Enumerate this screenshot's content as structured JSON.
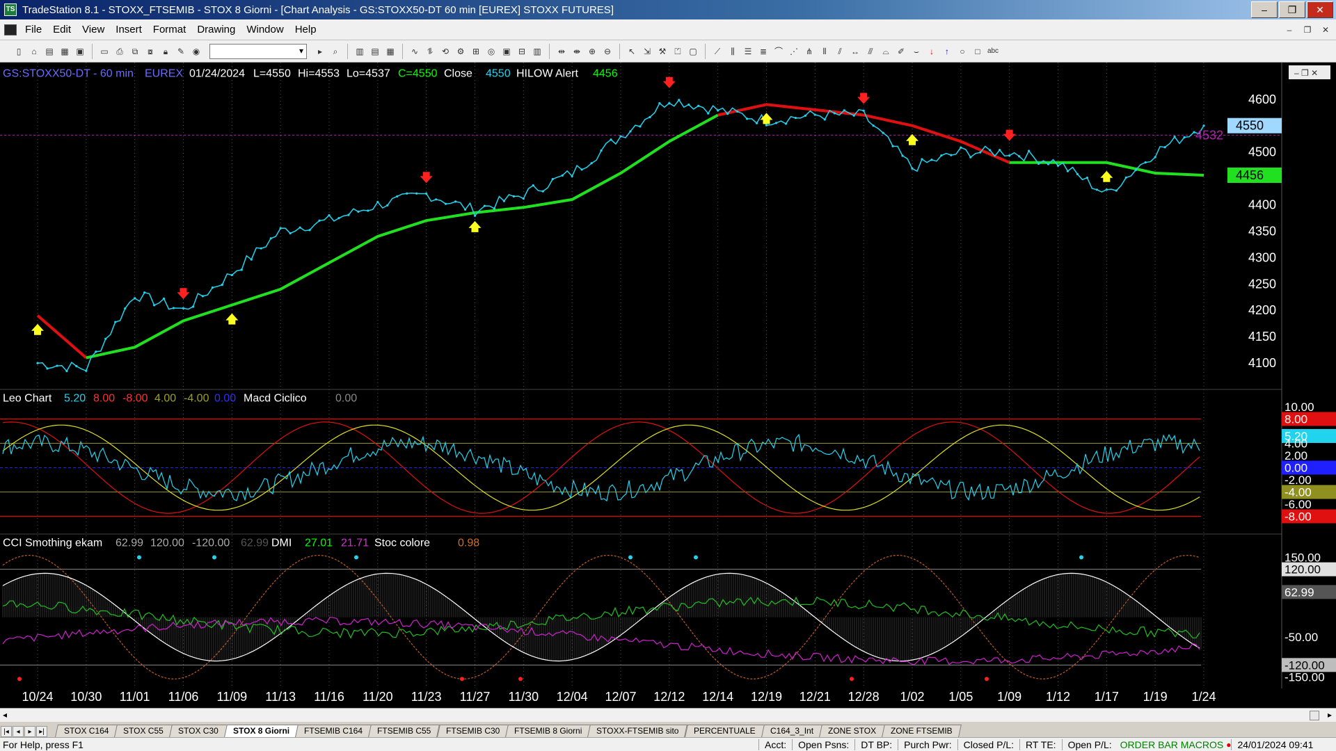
{
  "window": {
    "title": "TradeStation 8.1 - STOXX_FTSEMIB - STOX  8 Giorni - [Chart Analysis - GS:STOXX50-DT  60 min  [EUREX] STOXX FUTURES]"
  },
  "menu": [
    "File",
    "Edit",
    "View",
    "Insert",
    "Format",
    "Drawing",
    "Window",
    "Help"
  ],
  "header": {
    "symbol": "GS:STOXX50-DT - 60 min",
    "exchange": "EUREX",
    "date": "01/24/2024",
    "low": "L=4550",
    "hi": "Hi=4553",
    "lo": "Lo=4537",
    "close": "C=4550",
    "close_label": "Close",
    "close_value": "4550",
    "alert_label": "HILOW Alert",
    "alert_value": "4456"
  },
  "sub1": {
    "name": "Leo Chart",
    "v1": "5.20",
    "v2": "8.00",
    "v3": "-8.00",
    "v4": "4.00",
    "v5": "-4.00",
    "v6": "0.00",
    "name2": "Macd Ciclico",
    "v7": "0.00"
  },
  "sub2": {
    "name": "CCI Smothing ekam",
    "v1": "62.99",
    "v2": "120.00",
    "v3": "-120.00",
    "v4": "62.99",
    "name2": "DMI",
    "v5": "27.01",
    "v6": "21.71",
    "name3": "Stoc colore",
    "v7": "0.98"
  },
  "price_axis": {
    "ticks": [
      4600,
      4550,
      4500,
      4450,
      4400,
      4350,
      4300,
      4250,
      4200,
      4150,
      4100
    ],
    "marker_prev": "4532",
    "marker_close": "4550",
    "marker_alert": "4456"
  },
  "sub1_axis": {
    "ticks": [
      "10.00",
      "8.00",
      "5.20",
      "4.00",
      "2.00",
      "0.00",
      "-2.00",
      "-4.00",
      "-6.00",
      "-8.00"
    ]
  },
  "sub2_axis": {
    "ticks": [
      "150.00",
      "120.00",
      "62.99",
      "-50.00",
      "-120.00",
      "-150.00"
    ]
  },
  "dates": [
    "10/24",
    "10/30",
    "11/01",
    "11/06",
    "11/09",
    "11/13",
    "11/16",
    "11/20",
    "11/23",
    "11/27",
    "11/30",
    "12/04",
    "12/07",
    "12/12",
    "12/14",
    "12/19",
    "12/21",
    "12/28",
    "1/02",
    "1/05",
    "1/09",
    "1/12",
    "1/17",
    "1/19",
    "1/24"
  ],
  "tabs": [
    "STOX C164",
    "STOX C55",
    "STOX  C30",
    "STOX  8 Giorni",
    "FTSEMIB C164",
    "FTSEMIB C55",
    "FTSEMIB C30",
    "FTSEMIB  8 Giorni",
    "STOXX-FTSEMIB sito",
    "PERCENTUALE",
    "C164_3_Int",
    "ZONE STOX",
    "ZONE FTSEMIB"
  ],
  "active_tab": 3,
  "status": {
    "help": "For Help, press F1",
    "acct": "Acct:",
    "open_psns": "Open Psns:",
    "dt_bp": "DT BP:",
    "purch_pwr": "Purch Pwr:",
    "closed_pl": "Closed P/L:",
    "rt_te": "RT TE:",
    "open_pl": "Open P/L:",
    "order_macros": "ORDER BAR  MACROS",
    "datetime": "24/01/2024 09:41"
  },
  "chart_data": {
    "type": "line",
    "price_series": {
      "name": "GS:STOXX50-DT",
      "x": [
        "10/24",
        "10/30",
        "11/01",
        "11/06",
        "11/09",
        "11/13",
        "11/16",
        "11/20",
        "11/23",
        "11/27",
        "11/30",
        "12/04",
        "12/07",
        "12/12",
        "12/14",
        "12/19",
        "12/21",
        "12/28",
        "1/02",
        "1/05",
        "1/09",
        "1/12",
        "1/17",
        "1/19",
        "1/24"
      ],
      "values": [
        4100,
        4090,
        4230,
        4200,
        4270,
        4350,
        4370,
        4400,
        4420,
        4390,
        4420,
        4460,
        4530,
        4600,
        4580,
        4560,
        4570,
        4570,
        4470,
        4500,
        4500,
        4480,
        4420,
        4500,
        4550
      ]
    },
    "ma_series": {
      "x": [
        "10/24",
        "10/30",
        "11/01",
        "11/06",
        "11/09",
        "11/13",
        "11/16",
        "11/20",
        "11/23",
        "11/27",
        "11/30",
        "12/04",
        "12/07",
        "12/12",
        "12/14",
        "12/19",
        "12/21",
        "12/28",
        "1/02",
        "1/05",
        "1/09",
        "1/12",
        "1/17",
        "1/19",
        "1/24"
      ],
      "values": [
        4190,
        4110,
        4130,
        4180,
        4210,
        4240,
        4290,
        4340,
        4370,
        4385,
        4395,
        4410,
        4460,
        4520,
        4570,
        4590,
        4580,
        4570,
        4550,
        4520,
        4480,
        4480,
        4480,
        4460,
        4456
      ]
    },
    "ylim": [
      4050,
      4630
    ]
  }
}
